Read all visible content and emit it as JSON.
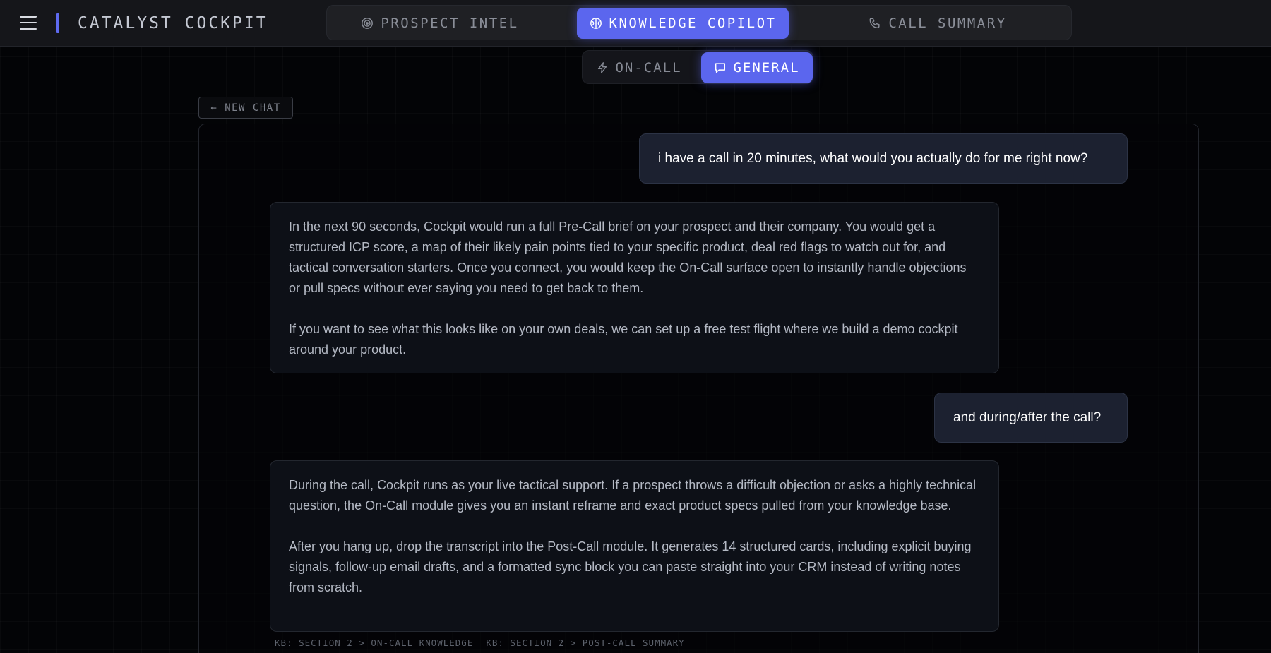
{
  "header": {
    "brand": "CATALYST COCKPIT",
    "menu_icon": "hamburger-menu-icon",
    "tabs": [
      {
        "label": "PROSPECT INTEL",
        "icon": "target-icon",
        "active": false
      },
      {
        "label": "KNOWLEDGE COPILOT",
        "icon": "brain-icon",
        "active": true
      },
      {
        "label": "CALL SUMMARY",
        "icon": "phone-icon",
        "active": false
      }
    ],
    "accent_color": "#5b66ee"
  },
  "subtabs": [
    {
      "label": "ON-CALL",
      "icon": "lightning-icon",
      "active": false
    },
    {
      "label": "GENERAL",
      "icon": "chat-bubble-icon",
      "active": true
    }
  ],
  "new_chat_label": "← NEW CHAT",
  "messages": [
    {
      "role": "user",
      "text": "i have a call in 20 minutes, what would you actually do for me right now?"
    },
    {
      "role": "assistant",
      "paragraphs": [
        "In the next 90 seconds, Cockpit would run a full Pre-Call brief on your prospect and their company. You would get a structured ICP score, a map of their likely pain points tied to your specific product, deal red flags to watch out for, and tactical conversation starters. Once you connect, you would keep the On-Call surface open to instantly handle objections or pull specs without ever saying you need to get back to them.",
        "If you want to see what this looks like on your own deals, we can set up a free test flight where we build a demo cockpit around your product."
      ]
    },
    {
      "role": "user",
      "text": "and during/after the call?"
    },
    {
      "role": "assistant",
      "paragraphs": [
        "During the call, Cockpit runs as your live tactical support. If a prospect throws a difficult objection or asks a highly technical question, the On-Call module gives you an instant reframe and exact product specs pulled from your knowledge base.",
        "After you hang up, drop the transcript into the Post-Call module. It generates 14 structured cards, including explicit buying signals, follow-up email drafts, and a formatted sync block you can paste straight into your CRM instead of writing notes from scratch."
      ]
    }
  ],
  "kb_sources": [
    "KB: SECTION 2 > ON-CALL KNOWLEDGE",
    "KB: SECTION 2 > POST-CALL SUMMARY"
  ]
}
